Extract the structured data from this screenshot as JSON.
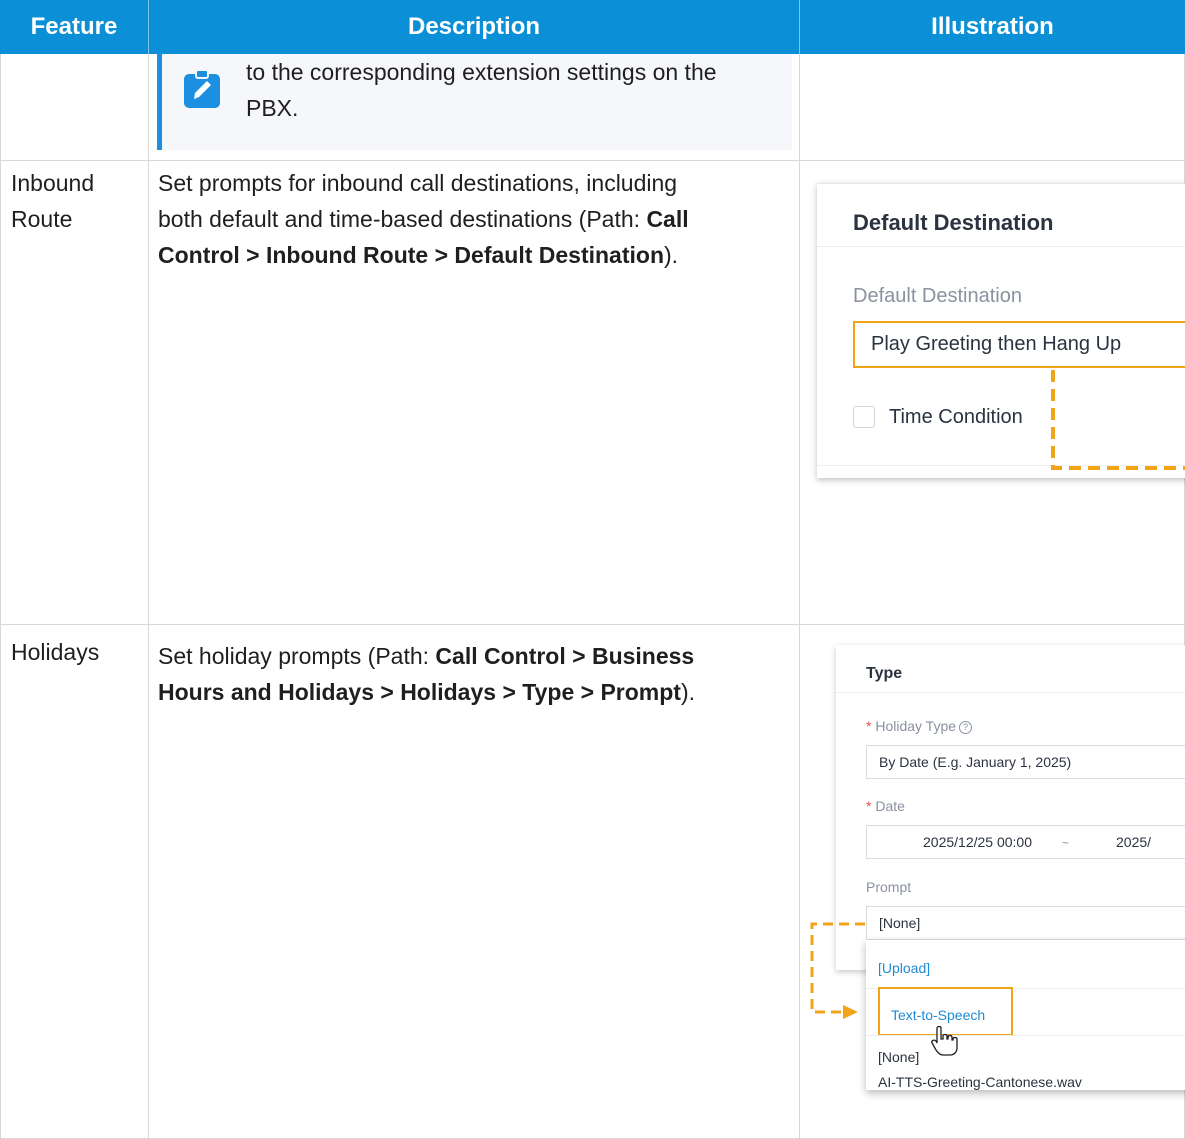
{
  "table": {
    "headers": [
      "Feature",
      "Description",
      "Illustration"
    ]
  },
  "note": {
    "line1": "to the corresponding extension settings on the",
    "line2": "PBX.",
    "icon": "edit-note-icon",
    "accent": "#1c8fe0"
  },
  "rows": [
    {
      "feature_line1": "Inbound",
      "feature_line2": "Route",
      "desc_line1": "Set prompts for inbound call destinations, including",
      "desc_line2_plain": "both default and time-based destinations (Path: ",
      "desc_line2_bold": "Call",
      "desc_line3_bold": "Control > Inbound Route > Default Destination",
      "desc_line3_plain": ")."
    },
    {
      "feature": "Holidays",
      "desc_line1_plain": "Set holiday prompts (Path: ",
      "desc_line1_bold": "Call Control > Business",
      "desc_line2_bold": "Hours and Holidays > Holidays > Type > Prompt",
      "desc_line2_plain": ")."
    }
  ],
  "illustration1": {
    "title": "Default Destination",
    "field_label": "Default Destination",
    "field_value": "Play Greeting then Hang Up",
    "checkbox_label": "Time Condition",
    "highlight_color": "#f2a31a"
  },
  "illustration2": {
    "title": "Type",
    "holiday_type_label": "Holiday Type",
    "holiday_type_value": "By Date (E.g. January 1, 2025)",
    "date_label": "Date",
    "date_start": "2025/12/25 00:00",
    "date_sep": "~",
    "date_end": "2025/",
    "prompt_label": "Prompt",
    "prompt_value": "[None]",
    "required_mark": "*",
    "help_mark": "?",
    "dropdown": {
      "upload": "[Upload]",
      "tts": "Text-to-Speech",
      "none": "[None]",
      "file": "AI-TTS-Greeting-Cantonese.wav"
    }
  },
  "colors": {
    "header_bg": "#0b8fd6",
    "highlight": "#f2a31a",
    "link": "#1f8ad6"
  }
}
